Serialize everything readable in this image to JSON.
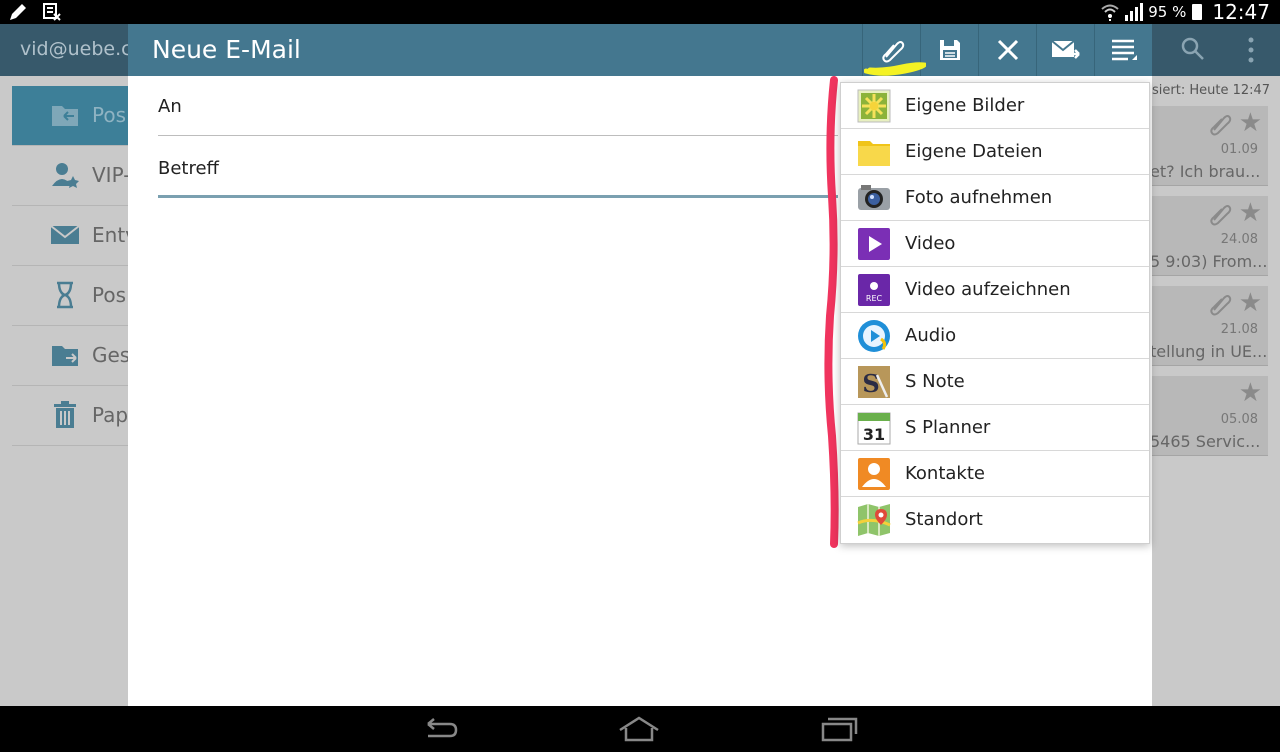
{
  "status_bar": {
    "battery": "95 %",
    "time": "12:47"
  },
  "background": {
    "account": "vid@uebe.c",
    "sidebar": [
      {
        "label": "Pos",
        "active": true
      },
      {
        "label": "VIP-"
      },
      {
        "label": "Entv"
      },
      {
        "label": "Pos"
      },
      {
        "label": "Ges"
      },
      {
        "label": "Pap"
      }
    ],
    "sync_text": "siert:  Heute 12:47",
    "messages": [
      {
        "date": "01.09",
        "snippet": "et? Ich brau..."
      },
      {
        "date": "24.08",
        "snippet": "5 9:03) From..."
      },
      {
        "date": "21.08",
        "snippet": "tellung in UE..."
      },
      {
        "date": "05.08",
        "snippet": "5465 Servic..."
      }
    ]
  },
  "compose": {
    "title": "Neue E-Mail",
    "to_label": "An",
    "subject_label": "Betreff"
  },
  "attach_menu": [
    {
      "label": "Eigene Bilder",
      "icon": "gallery-icon"
    },
    {
      "label": "Eigene Dateien",
      "icon": "folder-icon"
    },
    {
      "label": "Foto aufnehmen",
      "icon": "camera-icon"
    },
    {
      "label": "Video",
      "icon": "video-icon"
    },
    {
      "label": "Video aufzeichnen",
      "icon": "record-video-icon"
    },
    {
      "label": "Audio",
      "icon": "audio-icon"
    },
    {
      "label": "S Note",
      "icon": "s-note-icon"
    },
    {
      "label": "S Planner",
      "icon": "calendar-icon"
    },
    {
      "label": "Kontakte",
      "icon": "contacts-icon"
    },
    {
      "label": "Standort",
      "icon": "location-icon"
    }
  ],
  "colors": {
    "compose_bar": "#44778f",
    "background_header": "#37596b",
    "annotation_red": "#f0345e",
    "annotation_yellow": "#f4f224"
  }
}
